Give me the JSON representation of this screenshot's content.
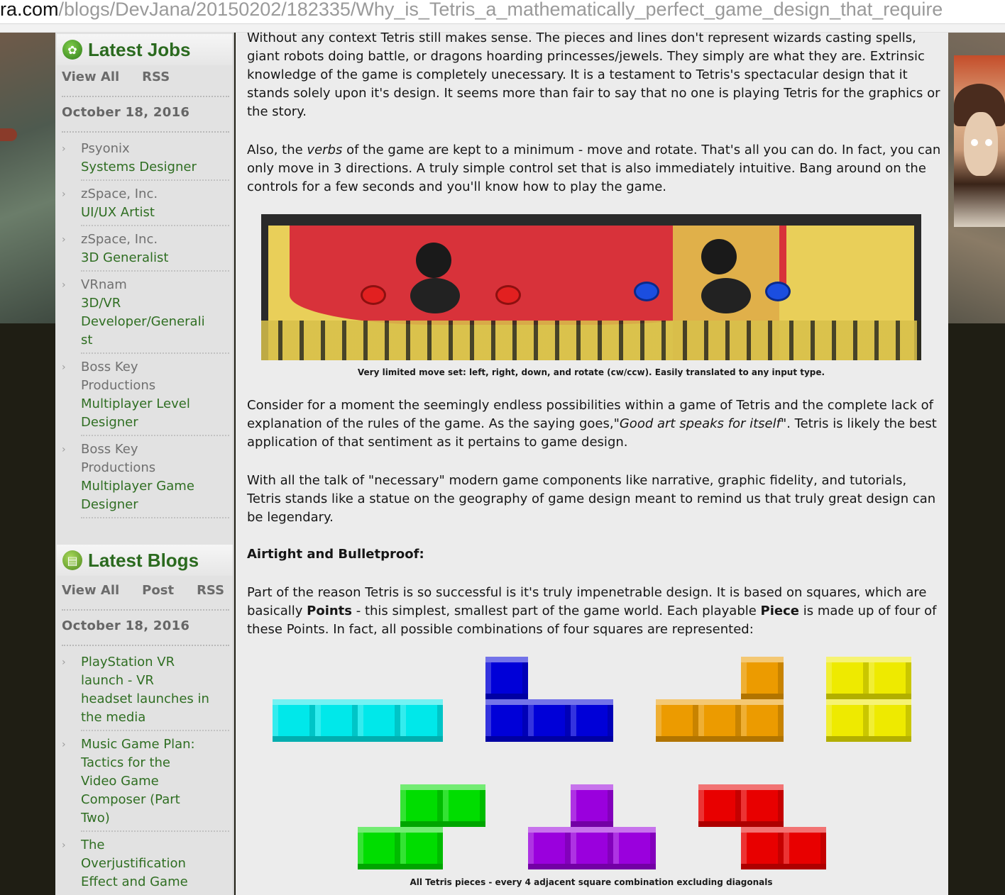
{
  "browser": {
    "url_host": "ra.com",
    "url_path": "/blogs/DevJana/20150202/182335/Why_is_Tetris_a_mathematically_perfect_game_design_that_require"
  },
  "sidebar": {
    "jobs": {
      "title": "Latest Jobs",
      "icon": "green-badge-icon",
      "links": [
        "View All",
        "RSS"
      ],
      "date": "October 18, 2016",
      "entries": [
        {
          "company": "Psyonix",
          "role_lines": [
            "Systems Designer"
          ]
        },
        {
          "company": "zSpace, Inc.",
          "role_lines": [
            "UI/UX Artist"
          ]
        },
        {
          "company": "zSpace, Inc.",
          "role_lines": [
            "3D Generalist"
          ]
        },
        {
          "company": "VRnam",
          "role_lines": [
            "3D/VR",
            "Developer/Generali",
            "st"
          ]
        },
        {
          "company": "Boss Key",
          "company2": "Productions",
          "role_lines": [
            "Multiplayer Level",
            "Designer"
          ]
        },
        {
          "company": "Boss Key",
          "company2": "Productions",
          "role_lines": [
            "Multiplayer Game",
            "Designer"
          ]
        }
      ]
    },
    "blogs": {
      "title": "Latest Blogs",
      "icon": "document-badge-icon",
      "links": [
        "View All",
        "Post",
        "RSS"
      ],
      "date": "October 18, 2016",
      "entries": [
        {
          "lines": [
            "PlayStation VR",
            "launch - VR",
            "headset launches in",
            "the media"
          ]
        },
        {
          "lines": [
            "Music Game Plan:",
            "Tactics for the",
            "Video Game",
            "Composer (Part",
            "Two)"
          ]
        },
        {
          "lines": [
            "The",
            "Overjustification",
            "Effect and Game"
          ]
        }
      ]
    }
  },
  "article": {
    "p1": "Without any context Tetris still makes sense. The pieces and lines don't represent wizards casting spells, giant robots doing battle, or dragons hoarding princesses/jewels. They simply are what they are. Extrinsic knowledge of the game is completely unecessary. It is a testament to Tetris's spectacular design that it stands solely upon it's design. It seems more than fair to say that no one is playing Tetris for the graphics or the story.",
    "p2_a": "Also, the ",
    "p2_em": "verbs",
    "p2_b": " of the game are kept to a minimum - move and rotate. That's all you can do. In fact, you can only move in 3 directions. A truly simple control set that is also immediately intuitive. Bang around on the controls for a few seconds and you'll know how to play the game.",
    "photo_caption": "Very limited move set: left, right, down, and rotate (cw/ccw). Easily translated to any input type.",
    "p3_a": "Consider for a moment the seemingly endless possibilities within a game of Tetris and the complete lack of explanation of the rules of the game. As the saying goes,\"",
    "p3_em": "Good art speaks for itself",
    "p3_b": "\". Tetris is likely the best application of that sentiment as it pertains to game design.",
    "p4": "With all the talk of \"necessary\" modern game components like narrative, graphic fidelity, and tutorials, Tetris stands like a statue on the geography of game design meant to remind us that truly great design can be legendary.",
    "heading": "Airtight and Bulletproof:",
    "p5_a": "Part of the reason Tetris is so successful is it's truly impenetrable design. It is based on squares, which are basically ",
    "p5_b1": "Points",
    "p5_c": " - this simplest, smallest part of the game world. Each playable ",
    "p5_b2": "Piece",
    "p5_d": " is made up of four of these Points. In fact, all possible combinations of four squares are represented:",
    "pieces_caption": "All Tetris pieces - every 4 adjacent square combination excluding diagonals",
    "piece_colors": {
      "I": "#00e8ea",
      "J": "#0000d8",
      "L": "#ec9b00",
      "O": "#eeea00",
      "S": "#00dd00",
      "T": "#9a00dd",
      "Z": "#e80000"
    }
  }
}
